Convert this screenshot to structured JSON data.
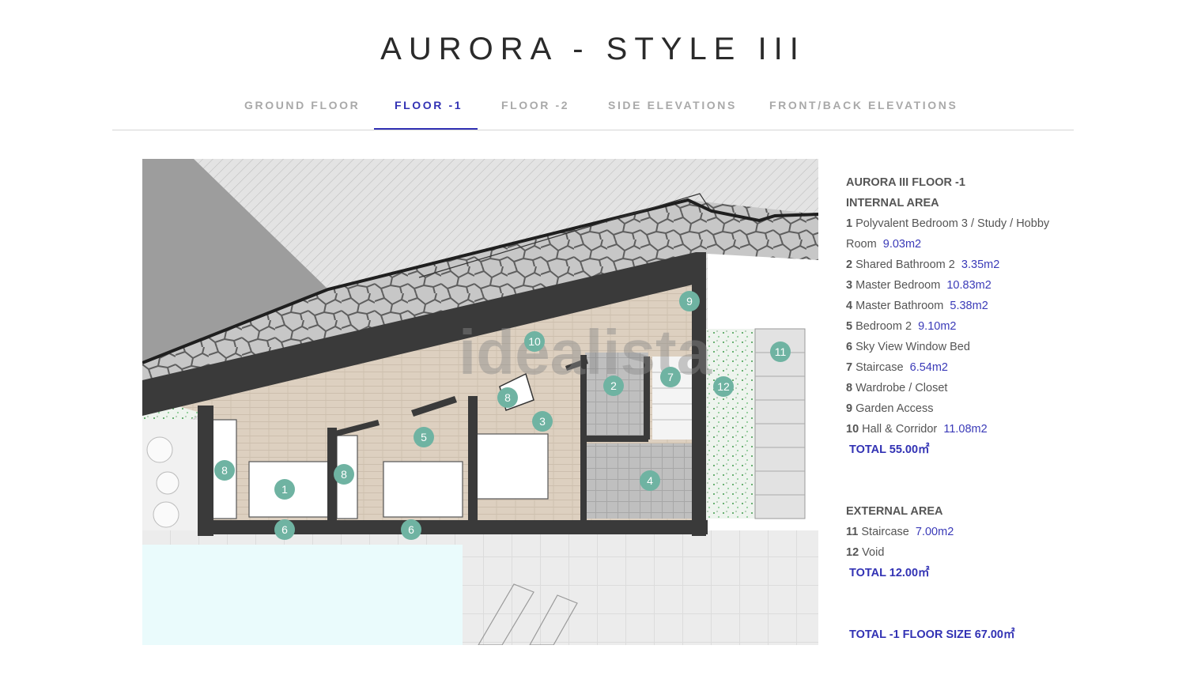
{
  "page": {
    "title": "AURORA - STYLE III"
  },
  "tabs": [
    {
      "label": "GROUND FLOOR",
      "active": false
    },
    {
      "label": "FLOOR -1",
      "active": true
    },
    {
      "label": "FLOOR -2",
      "active": false
    },
    {
      "label": "SIDE ELEVATIONS",
      "active": false
    },
    {
      "label": "FRONT/BACK ELEVATIONS",
      "active": false
    }
  ],
  "plan": {
    "watermark": "idealista",
    "markers": [
      "1",
      "2",
      "3",
      "4",
      "5",
      "6",
      "6",
      "7",
      "8",
      "8",
      "8",
      "9",
      "10",
      "11",
      "12"
    ]
  },
  "info": {
    "floor_title": "AURORA III FLOOR -1",
    "internal_heading": "INTERNAL AREA",
    "internal_rooms": [
      {
        "num": "1",
        "name": "Polyvalent Bedroom 3 / Study / Hobby Room",
        "area": "9.03m2"
      },
      {
        "num": "2",
        "name": "Shared Bathroom 2",
        "area": "3.35m2"
      },
      {
        "num": "3",
        "name": "Master Bedroom",
        "area": "10.83m2"
      },
      {
        "num": "4",
        "name": "Master Bathroom",
        "area": "5.38m2"
      },
      {
        "num": "5",
        "name": "Bedroom 2",
        "area": "9.10m2"
      },
      {
        "num": "6",
        "name": "Sky View Window Bed",
        "area": ""
      },
      {
        "num": "7",
        "name": "Staircase",
        "area": "6.54m2"
      },
      {
        "num": "8",
        "name": "Wardrobe / Closet",
        "area": ""
      },
      {
        "num": "9",
        "name": "Garden Access",
        "area": ""
      },
      {
        "num": "10",
        "name": "Hall & Corridor",
        "area": "11.08m2"
      }
    ],
    "internal_total": "TOTAL 55.00㎡",
    "external_heading": "EXTERNAL AREA",
    "external_rooms": [
      {
        "num": "11",
        "name": "Staircase",
        "area": "7.00m2"
      },
      {
        "num": "12",
        "name": "Void",
        "area": ""
      }
    ],
    "external_total": "TOTAL 12.00㎡",
    "floor_total": "TOTAL -1 FLOOR SIZE 67.00㎡"
  },
  "colors": {
    "accent": "#3232b4",
    "marker": "#6fb3a2",
    "wall": "#3a3a3a",
    "floor_wood": "#ddd0c0"
  }
}
